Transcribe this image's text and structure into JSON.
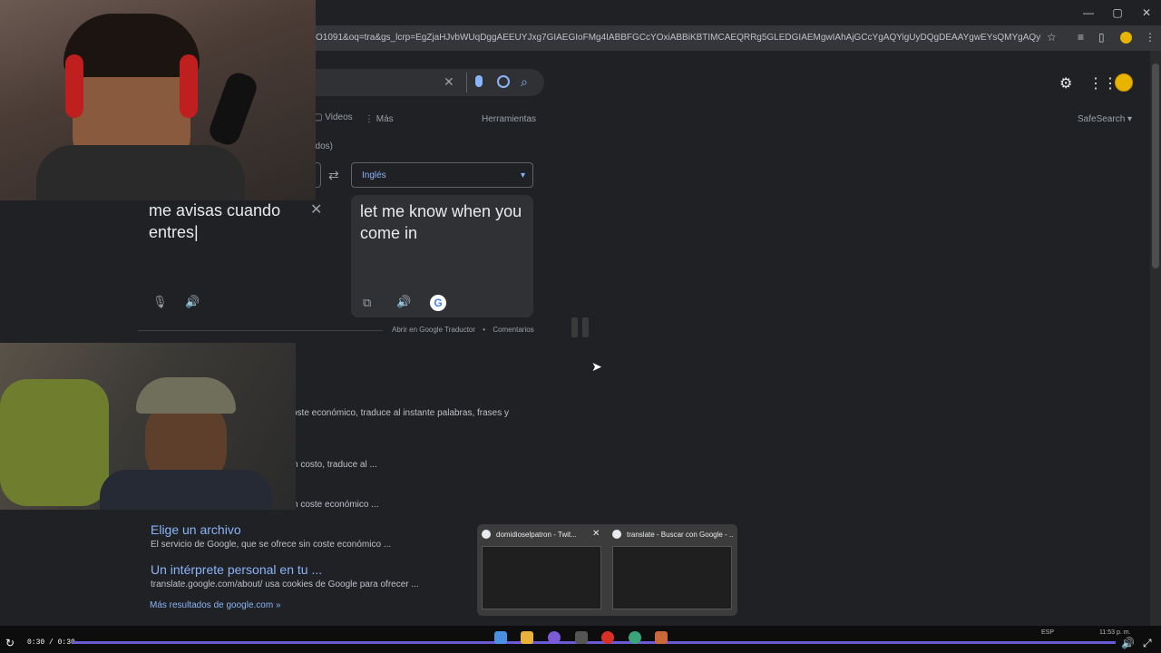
{
  "browser": {
    "url_fragment": "O1091&oq=tra&gs_lcrp=EgZjaHJvbWUqDggAEEUYJxg7GIAEGIoFMg4IABBFGCcYOxiABBiKBTIMCAEQRRg5GLEDGIAEMgwIAhAjGCcYgAQYigUyDQgDEAAYgwEYsQMYgAQyDQgEEAAYgwEYsQMYg...",
    "controls": {
      "minimize": "—",
      "restore": "▢",
      "close": "✕"
    }
  },
  "search": {
    "tabs": [
      {
        "label": "Videos"
      },
      {
        "label": "Más"
      }
    ],
    "tools_label": "Herramientas",
    "safesearch_label": "SafeSearch",
    "partial_text": "ndos)"
  },
  "translator": {
    "target_language": "Inglés",
    "source_text": "me avisas cuando entres|",
    "translated_text": "let me know when you come in",
    "open_link": "Abrir en Google Traductor",
    "separator": "•",
    "feedback_link": "Comentarios"
  },
  "results": [
    {
      "snippet": "oste económico, traduce al instante palabras, frases y"
    },
    {
      "snippet": "n costo, traduce al ..."
    },
    {
      "snippet": "n coste económico ..."
    },
    {
      "title": "Elige un archivo",
      "snippet": "El servicio de Google, que se ofrece sin coste económico ..."
    },
    {
      "title": "Un intérprete personal en tu ...",
      "snippet": "translate.google.com/about/ usa cookies de Google para ofrecer ..."
    }
  ],
  "more_results": "Más resultados de google.com »",
  "taskbar_previews": [
    {
      "title": "domidioselpatron - Twit..."
    },
    {
      "title": "translate - Buscar con Google - ..."
    }
  ],
  "player": {
    "time": "0:30 / 0:30",
    "progress": 1.0,
    "lang": "ESP",
    "clock": "11:53 p. m."
  },
  "colors": {
    "background": "#202124",
    "link": "#8ab4f8",
    "progress": "#6b5ad6"
  }
}
